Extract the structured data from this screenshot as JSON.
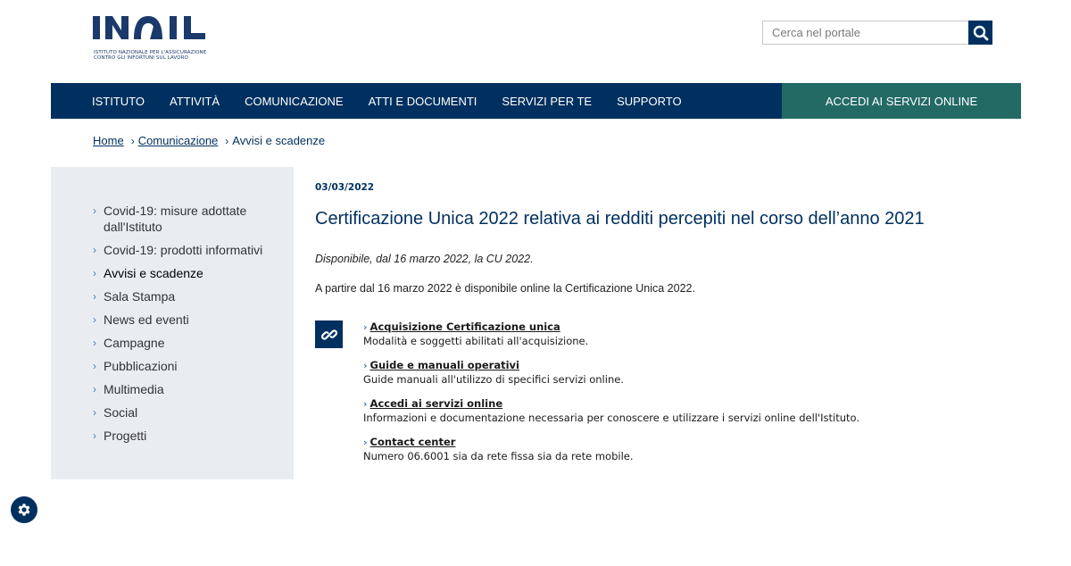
{
  "header": {
    "logo_text": "INAIL",
    "logo_sub_line1": "ISTITUTO NAZIONALE PER L'ASSICURAZIONE",
    "logo_sub_line2": "CONTRO GLI INFORTUNI SUL LAVORO",
    "search_placeholder": "Cerca nel portale",
    "search_icon": "search-icon"
  },
  "nav": {
    "items": [
      "ISTITUTO",
      "ATTIVITÀ",
      "COMUNICAZIONE",
      "ATTI E DOCUMENTI",
      "SERVIZI PER TE",
      "SUPPORTO"
    ],
    "cta": "ACCEDI AI SERVIZI ONLINE"
  },
  "breadcrumb": {
    "home": "Home",
    "section": "Comunicazione",
    "current": "Avvisi e scadenze"
  },
  "sidebar": {
    "items": [
      "Covid-19: misure adottate dall'Istituto",
      "Covid-19: prodotti informativi",
      "Avvisi e scadenze",
      "Sala Stampa",
      "News ed eventi",
      "Campagne",
      "Pubblicazioni",
      "Multimedia",
      "Social",
      "Progetti"
    ],
    "active_index": 2
  },
  "article": {
    "date": "03/03/2022",
    "title": "Certificazione Unica 2022 relativa ai redditi percepiti nel corso dell’anno 2021",
    "lead": "Disponibile, dal 16 marzo 2022, la CU 2022.",
    "body": "A partire dal 16 marzo 2022 è disponibile online la Certificazione Unica 2022.",
    "links": [
      {
        "title": "Acquisizione Certificazione unica",
        "desc": "Modalità e soggetti abilitati all'acquisizione."
      },
      {
        "title": "Guide e manuali operativi",
        "desc": "Guide manuali all'utilizzo di specifici servizi online."
      },
      {
        "title": "Accedi ai servizi online",
        "desc": "Informazioni e documentazione necessaria per conoscere e utilizzare i servizi online dell'Istituto."
      },
      {
        "title": "Contact center",
        "desc": "Numero 06.6001 sia da rete fissa sia da rete mobile."
      }
    ]
  },
  "colors": {
    "primary": "#00305f",
    "cta": "#236a65",
    "sidebar_bg": "#e9edf2",
    "chevron": "#4a7ab5"
  }
}
